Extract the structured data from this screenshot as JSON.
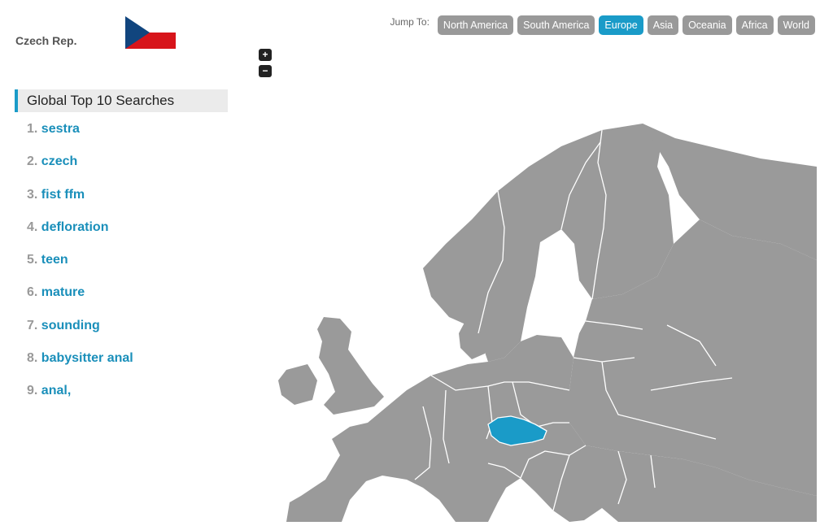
{
  "country": {
    "name": "Czech Rep.",
    "flag_colors": {
      "top": "#ffffff",
      "bottom": "#d7141a",
      "triangle": "#11457e"
    }
  },
  "jump": {
    "label": "Jump To:",
    "regions": [
      "North America",
      "South America",
      "Europe",
      "Asia",
      "Oceania",
      "Africa",
      "World"
    ],
    "active": "Europe"
  },
  "zoom": {
    "in": "+",
    "out": "−"
  },
  "searches": {
    "title": "Global Top 10 Searches",
    "items": [
      {
        "rank": "1.",
        "term": "sestra"
      },
      {
        "rank": "2.",
        "term": "czech"
      },
      {
        "rank": "3.",
        "term": "fist ffm"
      },
      {
        "rank": "4.",
        "term": "defloration"
      },
      {
        "rank": "5.",
        "term": "teen"
      },
      {
        "rank": "6.",
        "term": "mature"
      },
      {
        "rank": "7.",
        "term": "sounding"
      },
      {
        "rank": "8.",
        "term": "babysitter anal"
      },
      {
        "rank": "9.",
        "term": "anal,"
      }
    ]
  },
  "map": {
    "region": "Europe",
    "highlighted_country": "Czech Republic",
    "colors": {
      "land": "#9a9a9a",
      "highlight": "#1a9bc8",
      "borders": "#ffffff"
    }
  }
}
